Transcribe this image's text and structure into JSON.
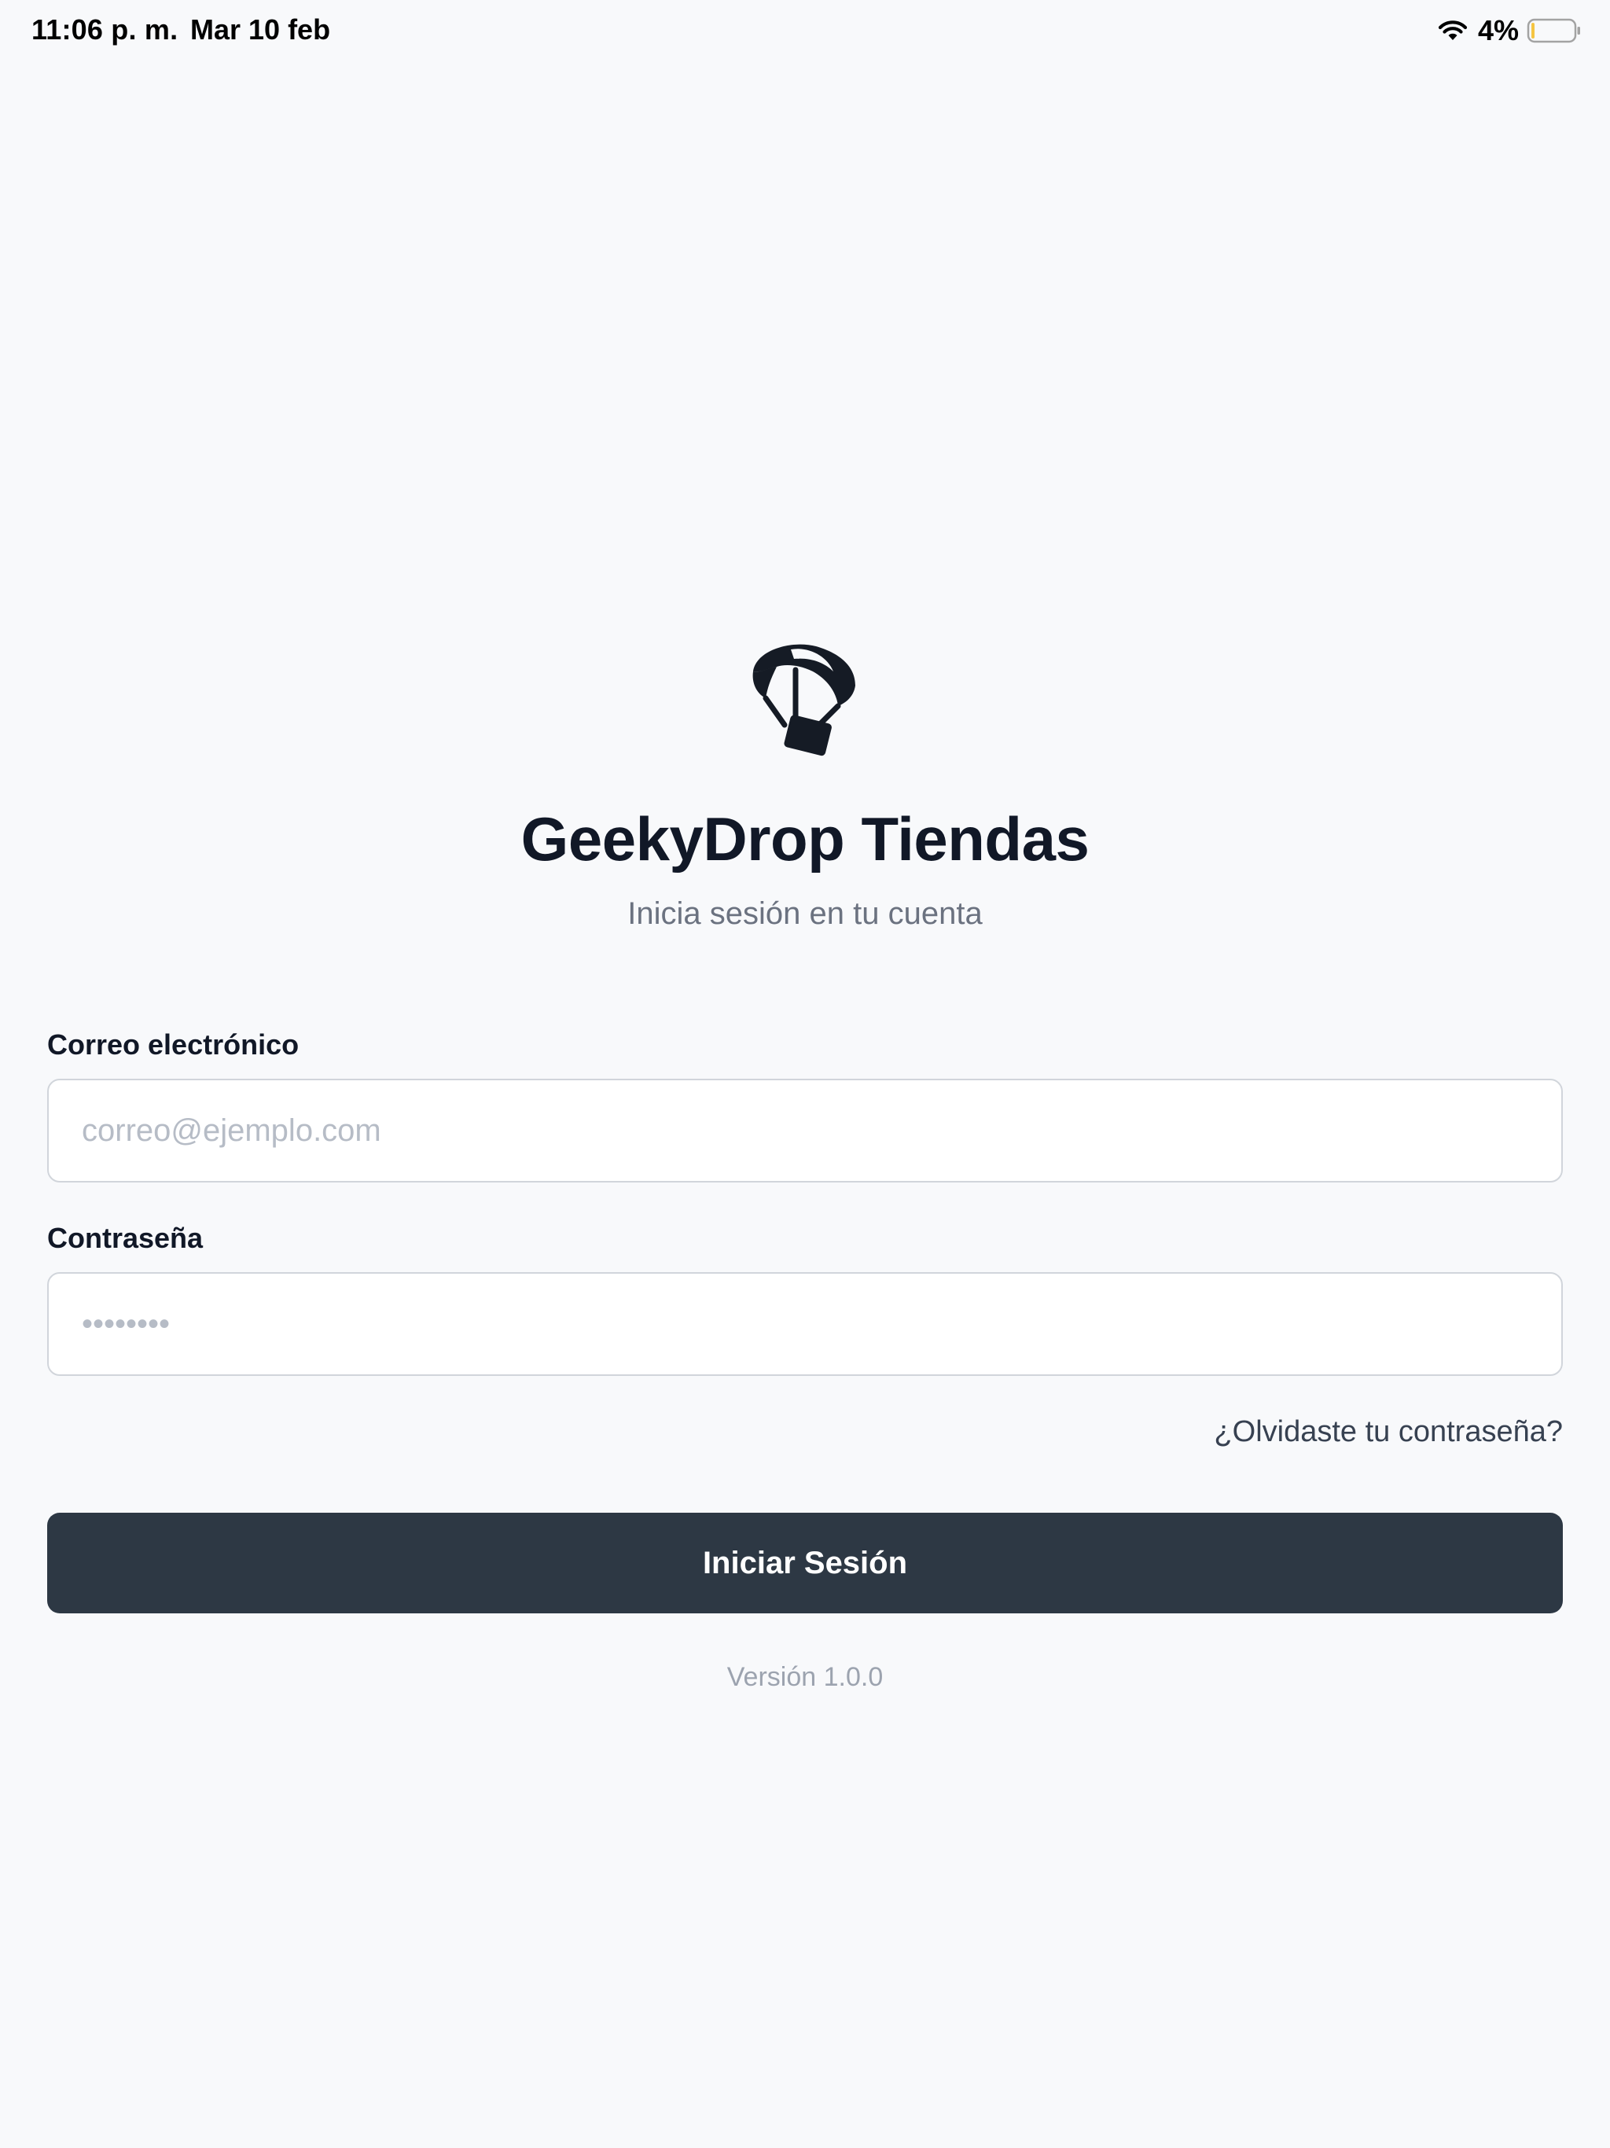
{
  "status_bar": {
    "time": "11:06 p. m.",
    "date": "Mar 10 feb",
    "battery": "4%",
    "icons": [
      "wifi-icon",
      "battery-icon"
    ]
  },
  "header": {
    "logo_icon": "parachute-drop-icon",
    "title": "GeekyDrop Tiendas",
    "subtitle": "Inicia sesión en tu cuenta"
  },
  "form": {
    "email_label": "Correo electrónico",
    "email_placeholder": "correo@ejemplo.com",
    "email_value": "",
    "password_label": "Contraseña",
    "password_placeholder": "••••••••",
    "password_value": "",
    "forgot_password": "¿Olvidaste tu contraseña?",
    "submit_label": "Iniciar Sesión"
  },
  "footer": {
    "version": "Versión 1.0.0"
  },
  "colors": {
    "background": "#f8f9fb",
    "title": "#111827",
    "subtitle": "#6b7280",
    "button_bg": "#2d3844",
    "button_text": "#ffffff",
    "input_border": "#d1d5db",
    "battery_level": "#f5c542"
  }
}
